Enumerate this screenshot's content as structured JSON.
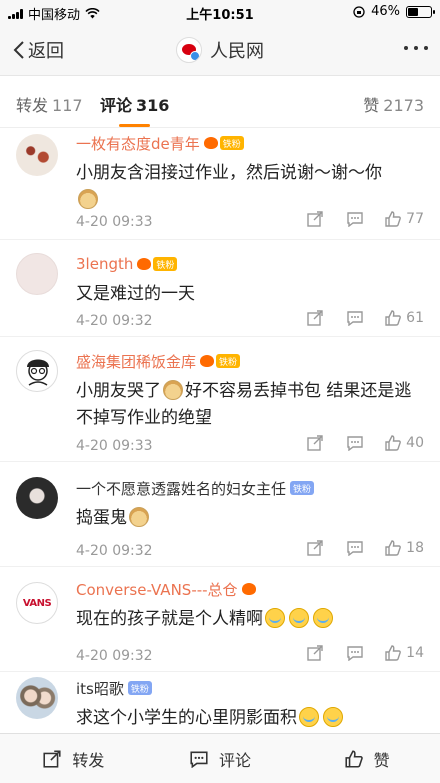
{
  "status_bar": {
    "carrier": "中国移动",
    "time": "上午10:51",
    "battery": "46%",
    "battery_level": 0.46
  },
  "nav": {
    "back_label": "返回",
    "title": "人民网"
  },
  "tabs": [
    {
      "label": "转发",
      "count": "117"
    },
    {
      "label": "评论",
      "count": "316"
    },
    {
      "label": "赞",
      "count": "2173"
    }
  ],
  "comments": [
    {
      "name": "一枚有态度de青年",
      "badge": "铁粉",
      "text": "小朋友含泪接过作业，然后说谢～谢～你",
      "time": "4-20 09:33",
      "likes": "77"
    },
    {
      "name": "3length",
      "badge": "铁粉",
      "text": "又是难过的一天",
      "time": "4-20 09:32",
      "likes": "61"
    },
    {
      "name": "盛海集团稀饭金库",
      "badge": "铁粉",
      "text_a": "小朋友哭了",
      "text_b": "好不容易丢掉书包 结果还是逃不掉写作业的绝望",
      "time": "4-20 09:33",
      "likes": "40"
    },
    {
      "name": "一个不愿意透露姓名的妇女主任",
      "badge": "铁粉",
      "text": "捣蛋鬼",
      "time": "4-20 09:32",
      "likes": "18"
    },
    {
      "name": "Converse-VANS---总仓",
      "text": "现在的孩子就是个人精啊",
      "time": "4-20 09:32",
      "likes": "14",
      "avatar_text": "VANS"
    },
    {
      "name": "its昭歌",
      "badge": "铁粉",
      "text": "求这个小学生的心里阴影面积"
    }
  ],
  "bottom_bar": {
    "repost": "转发",
    "comment": "评论",
    "like": "赞"
  },
  "colors": {
    "accent": "#ff8200",
    "username": "#eb7350",
    "badge_gold": "#ffb400",
    "badge_blue": "#83a6f3"
  }
}
